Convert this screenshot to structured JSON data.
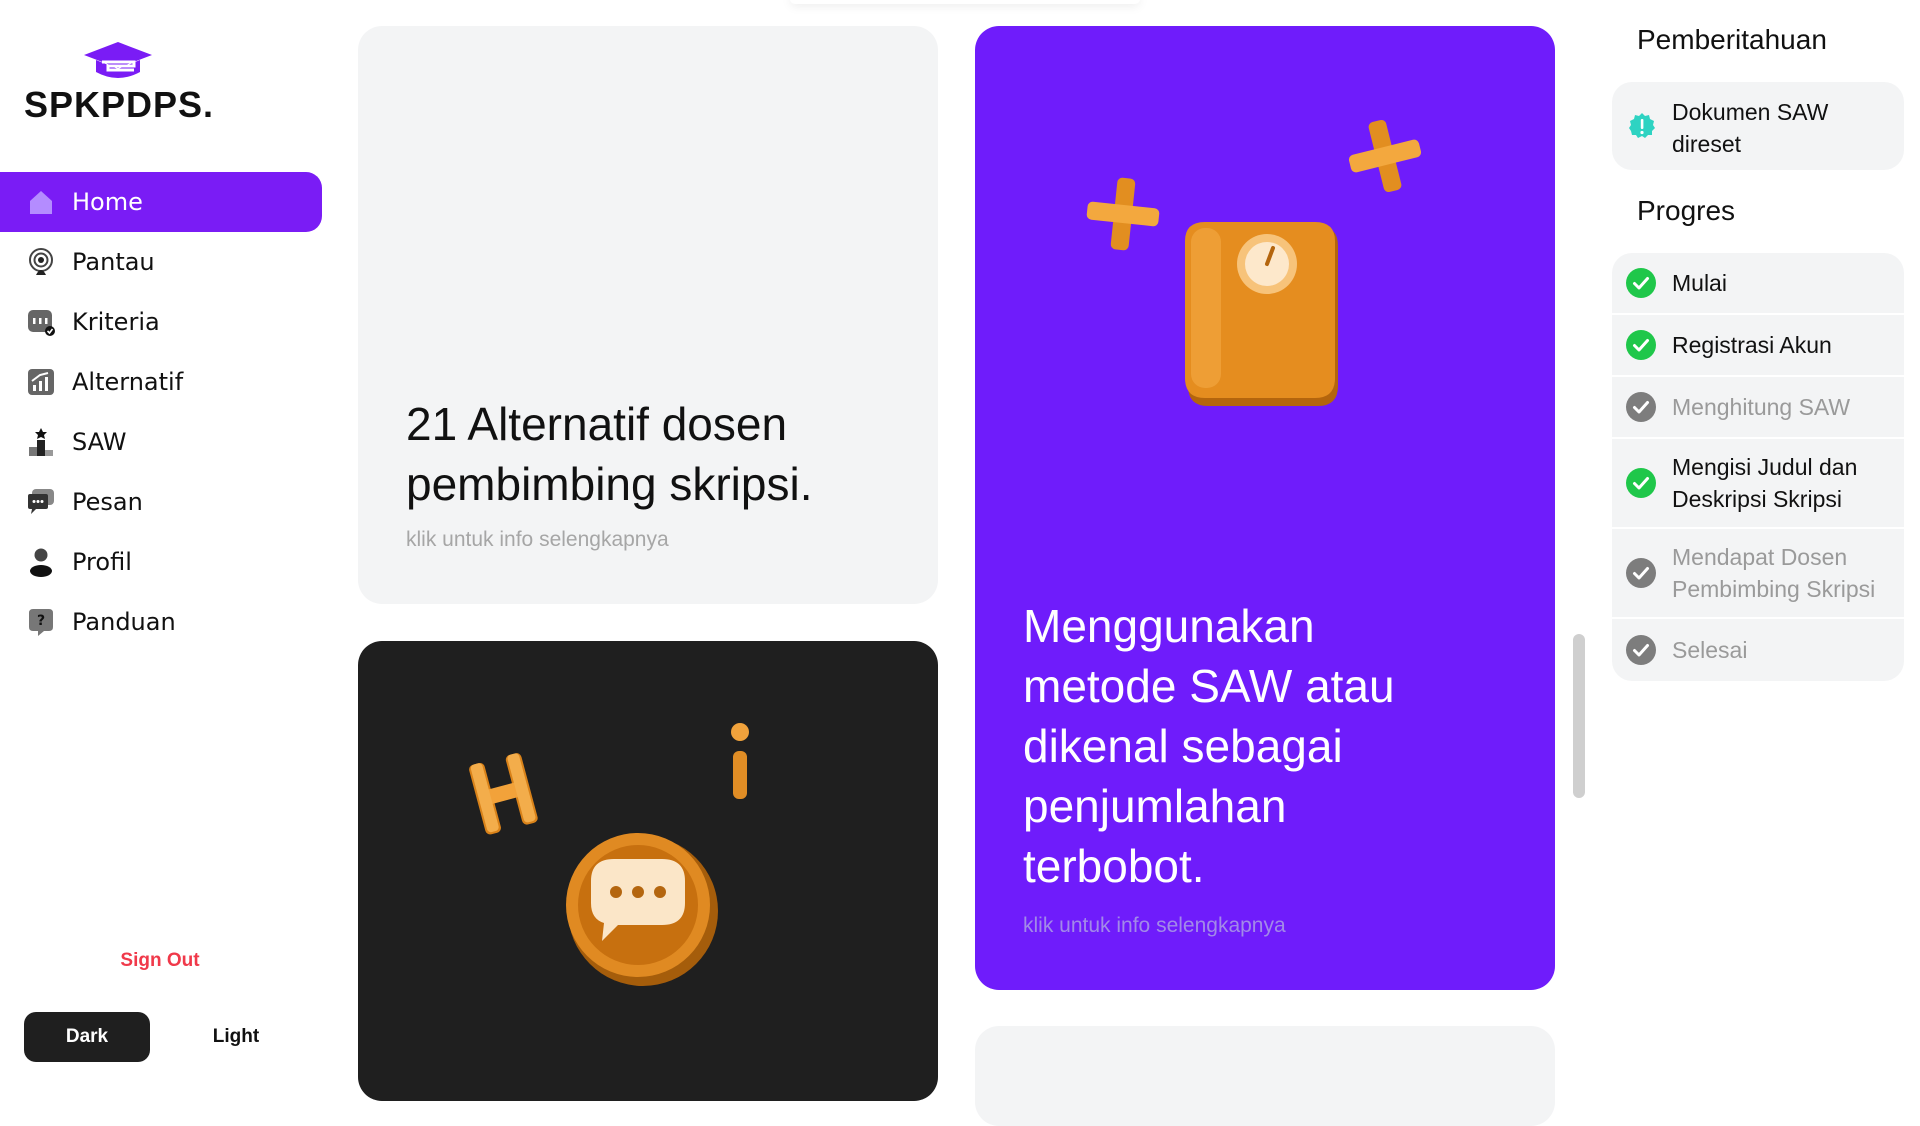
{
  "brand": {
    "name": "SPKPDPS.",
    "accent": "#7a1cf5"
  },
  "nav": [
    {
      "label": "Home",
      "icon": "home-icon",
      "active": true
    },
    {
      "label": "Pantau",
      "icon": "broadcast-icon"
    },
    {
      "label": "Kriteria",
      "icon": "criteria-icon"
    },
    {
      "label": "Alternatif",
      "icon": "chart-icon"
    },
    {
      "label": "SAW",
      "icon": "podium-icon"
    },
    {
      "label": "Pesan",
      "icon": "chat-icon"
    },
    {
      "label": "Profil",
      "icon": "user-icon"
    },
    {
      "label": "Panduan",
      "icon": "help-icon"
    }
  ],
  "sidebar": {
    "signout_label": "Sign Out",
    "dark_label": "Dark",
    "light_label": "Light"
  },
  "cards": {
    "alternatif": {
      "title_line1": "21 Alternatif dosen",
      "title_line2": "pembimbing skripsi.",
      "sub": "klik untuk info selengkapnya"
    },
    "saw": {
      "title_lines": [
        "Menggunakan",
        "metode SAW atau",
        "dikenal sebagai",
        "penjumlahan",
        "terbobot."
      ],
      "sub": "klik untuk info selengkapnya"
    }
  },
  "notifications": {
    "heading": "Pemberitahuan",
    "items": [
      {
        "line1": "Dokumen SAW",
        "line2": "direset"
      }
    ]
  },
  "progress": {
    "heading": "Progres",
    "items": [
      {
        "line1": "Mulai",
        "line2": "",
        "done": true
      },
      {
        "line1": "Registrasi Akun",
        "line2": "",
        "done": true
      },
      {
        "line1": "Menghitung SAW",
        "line2": "",
        "done": false
      },
      {
        "line1": "Mengisi Judul dan",
        "line2": "Deskripsi Skripsi",
        "done": true
      },
      {
        "line1": "Mendapat Dosen",
        "line2": "Pembimbing Skripsi",
        "done": false
      },
      {
        "line1": "Selesai",
        "line2": "",
        "done": false
      }
    ]
  }
}
